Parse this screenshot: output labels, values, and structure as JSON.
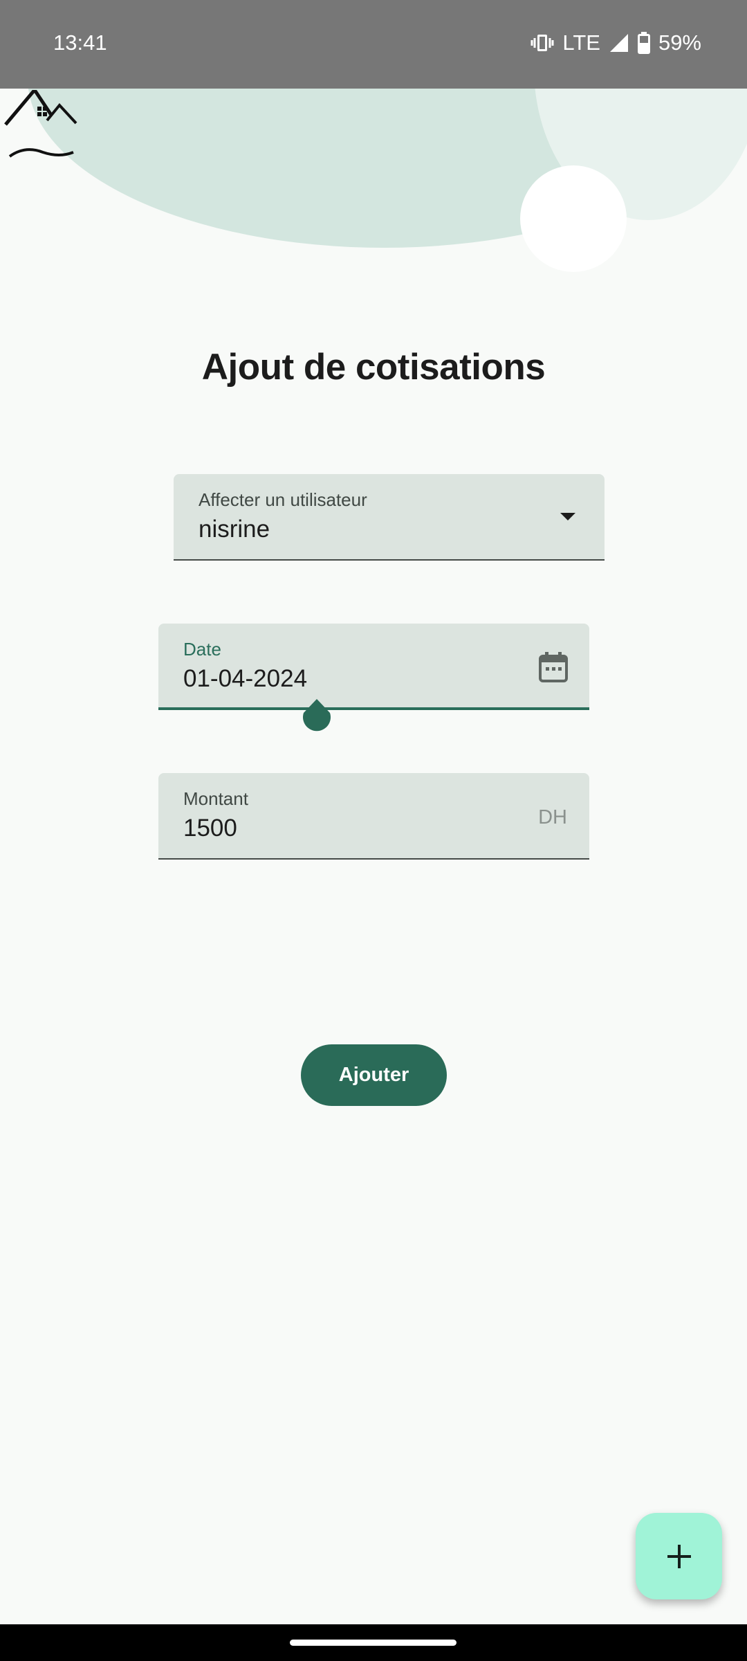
{
  "status_bar": {
    "time": "13:41",
    "network": "LTE",
    "battery": "59%",
    "icons": [
      "vibrate-icon",
      "signal-icon",
      "battery-icon"
    ]
  },
  "page": {
    "title": "Ajout de cotisations"
  },
  "form": {
    "user_field": {
      "label": "Affecter un utilisateur",
      "value": "nisrine"
    },
    "date_field": {
      "label": "Date",
      "value": "01-04-2024"
    },
    "amount_field": {
      "label": "Montant",
      "value": "1500",
      "suffix": "DH"
    },
    "submit_label": "Ajouter"
  },
  "colors": {
    "primary": "#2a6b58",
    "fab": "#a0f3d7",
    "field_background": "#dce4df",
    "header_blob": "#d3e6df"
  }
}
